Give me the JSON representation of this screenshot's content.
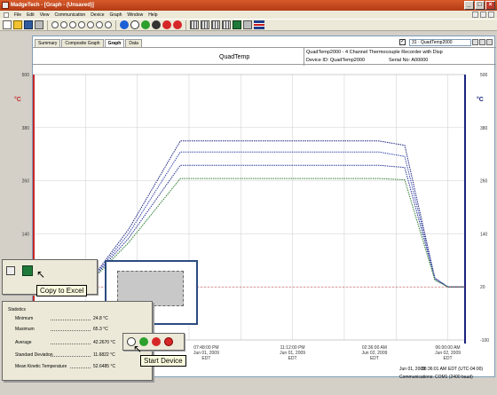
{
  "window": {
    "title": "MadgeTech - [Graph - (Unsaved)]",
    "min": "_",
    "max": "□",
    "close": "×"
  },
  "menu": [
    "File",
    "Edit",
    "View",
    "Communication",
    "Device",
    "Graph",
    "Window",
    "Help"
  ],
  "tabs": [
    "Summary",
    "Composite Graph",
    "Graph",
    "Data"
  ],
  "active_tab": "Graph",
  "channel_selector": {
    "checked": "✓",
    "value": "31 · QuadTemp2000"
  },
  "header": {
    "title": "QuadTemp",
    "device_desc": "QuadTemp2000 - 4 Channel Thermocouple Recorder with Disp",
    "device_id": "Device ID: QuadTemp2000",
    "serial": "Serial No: A00000"
  },
  "chart_data": {
    "type": "line",
    "y_unit_left": "°C",
    "y_unit_right": "°C",
    "y_ticks_left": [
      "500",
      "380",
      "260",
      "140",
      "20",
      "-100"
    ],
    "y_ticks_right": [
      "500",
      "380",
      "260",
      "140",
      "20",
      "-100"
    ],
    "ylim": [
      -100,
      500
    ],
    "x_ticks": [
      {
        "time": "07:48:00 PM",
        "date": "Jun 01, 2009",
        "tz": "EDT"
      },
      {
        "time": "11:12:00 PM",
        "date": "Jun 01, 2009",
        "tz": "EDT"
      },
      {
        "time": "02:36:00 AM",
        "date": "Jun 02, 2009",
        "tz": "EDT"
      },
      {
        "time": "06:00:00 AM",
        "date": "Jun 02, 2009",
        "tz": "EDT"
      }
    ],
    "grid": true,
    "series": [
      {
        "color": "#1a237e",
        "values": [
          20,
          20,
          150,
          350,
          350,
          350,
          350,
          350,
          350,
          340,
          40,
          20,
          20,
          20
        ]
      },
      {
        "color": "#3949ab",
        "values": [
          20,
          20,
          140,
          325,
          325,
          325,
          325,
          325,
          325,
          315,
          40,
          20,
          20,
          20
        ]
      },
      {
        "color": "#283593",
        "values": [
          20,
          20,
          130,
          295,
          295,
          295,
          295,
          295,
          295,
          290,
          38,
          20,
          20,
          20
        ]
      },
      {
        "color": "#2e7d32",
        "values": [
          20,
          20,
          120,
          265,
          265,
          265,
          265,
          265,
          265,
          262,
          35,
          20,
          20,
          20
        ]
      }
    ],
    "x_positions": [
      0,
      0.12,
      0.22,
      0.34,
      0.45,
      0.55,
      0.62,
      0.72,
      0.8,
      0.86,
      0.93,
      0.96,
      0.98,
      1
    ]
  },
  "popups": {
    "copy_excel_tooltip": "Copy to Excel",
    "start_device_tooltip": "Start Device"
  },
  "statistics": {
    "title": "Statistics",
    "rows": [
      {
        "label": "Minimum",
        "value": "24.8 °C"
      },
      {
        "label": "Maximum",
        "value": "65.3 °C"
      },
      {
        "label": "Average",
        "value": "42.2670 °C"
      },
      {
        "label": "Standard Deviation",
        "value": "11.6822 °C"
      },
      {
        "label": "Mean Kinetic Temperature",
        "value": "52.6485 °C"
      }
    ]
  },
  "status": {
    "date": "Jun 01, 2009",
    "time": "08:36:01 AM",
    "tz": "EDT (UTC-04:00)",
    "comm": "Communications: COM1 (2400 baud)"
  },
  "colors": {
    "left_axis": "#c62828",
    "right_axis": "#1a237e"
  }
}
